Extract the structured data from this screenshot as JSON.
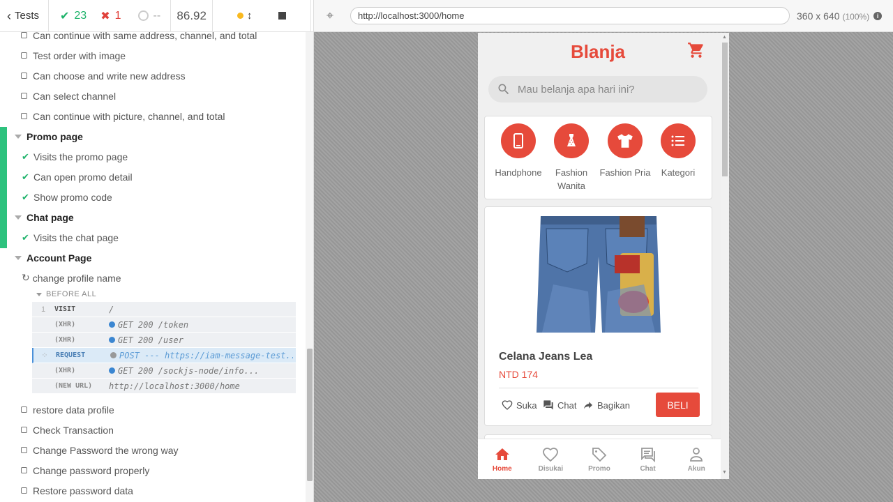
{
  "reporter": {
    "tests_button": "Tests",
    "passed": "23",
    "failed": "1",
    "pending": "--",
    "duration": "86.92"
  },
  "tests": {
    "above": [
      "Can continue with same address, channel, and total",
      "Test order with image",
      "Can choose and write new address",
      "Can select channel",
      "Can continue with picture, channel, and total"
    ],
    "promo_suite": "Promo page",
    "promo_tests": [
      "Visits the promo page",
      "Can open promo detail",
      "Show promo code"
    ],
    "chat_suite": "Chat page",
    "chat_tests": [
      "Visits the chat page"
    ],
    "account_suite": "Account Page",
    "running_test": "change profile name",
    "hook_title": "BEFORE ALL",
    "commands": [
      {
        "idx": "1",
        "name": "VISIT",
        "msg": "/"
      },
      {
        "idx": "",
        "name": "(XHR)",
        "msg": "GET 200 /token"
      },
      {
        "idx": "",
        "name": "(XHR)",
        "msg": "GET 200 /user"
      },
      {
        "idx": "",
        "name": "REQUEST",
        "msg": "POST --- https://iam-message-test..."
      },
      {
        "idx": "",
        "name": "(XHR)",
        "msg": "GET 200 /sockjs-node/info..."
      },
      {
        "idx": "",
        "name": "(NEW URL)",
        "msg": "http://localhost:3000/home"
      }
    ],
    "below": [
      "restore data profile",
      "Check Transaction",
      "Change Password the wrong way",
      "Change password properly",
      "Restore password data"
    ]
  },
  "aut": {
    "url": "http://localhost:3000/home",
    "viewport": "360 x 640",
    "zoom": "(100%)",
    "info": "i"
  },
  "app": {
    "brand": "Blanja",
    "search_placeholder": "Mau belanja apa hari ini?",
    "categories": [
      {
        "name": "Handphone",
        "icon": "phone-icon"
      },
      {
        "name": "Fashion Wanita",
        "icon": "dress-icon"
      },
      {
        "name": "Fashion Pria",
        "icon": "shirt-icon"
      },
      {
        "name": "Kategori",
        "icon": "list-icon"
      }
    ],
    "product": {
      "name": "Celana Jeans Lea",
      "price": "NTD 174",
      "like": "Suka",
      "chat": "Chat",
      "share": "Bagikan",
      "buy": "BELI"
    },
    "nav": [
      {
        "label": "Home",
        "icon": "home-icon",
        "active": true
      },
      {
        "label": "Disukai",
        "icon": "heart-icon",
        "active": false
      },
      {
        "label": "Promo",
        "icon": "tag-icon",
        "active": false
      },
      {
        "label": "Chat",
        "icon": "chat-icon",
        "active": false
      },
      {
        "label": "Akun",
        "icon": "user-icon",
        "active": false
      }
    ],
    "brand_color": "#e64a3b"
  }
}
